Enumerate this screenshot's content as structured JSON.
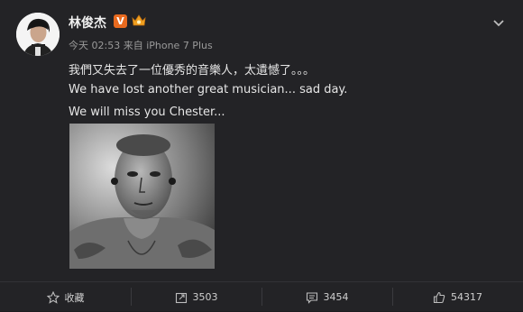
{
  "post": {
    "author": "林俊杰",
    "verified_badge": "V",
    "meta": "今天 02:53 来自 iPhone 7 Plus",
    "lines": [
      "我們又失去了一位優秀的音樂人，太遺憾了。。。",
      "We have lost another great musician... sad day.",
      "We will miss you Chester..."
    ]
  },
  "actions": {
    "favorite_label": "收藏",
    "repost_count": "3503",
    "comment_count": "3454",
    "like_count": "54317"
  },
  "colors": {
    "background": "#232326",
    "verified": "#e86a1f",
    "vip": "#f0a020",
    "muted_text": "#9a9a9a"
  },
  "icons": [
    "avatar",
    "verified-badge-icon",
    "vip-crown-icon",
    "chevron-down-icon",
    "star-icon",
    "repost-icon",
    "comment-icon",
    "like-icon"
  ]
}
